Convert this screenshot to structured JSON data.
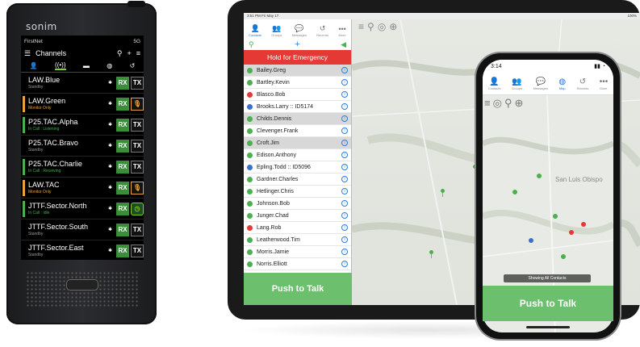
{
  "handset": {
    "brand": "sonim",
    "status_left": "FirstNet",
    "status_right": "5G",
    "title": "Channels",
    "tab_icons": [
      "person-icon",
      "radio-icon",
      "bus-icon",
      "globe-icon",
      "history-icon"
    ],
    "channels": [
      {
        "name": "LAW.Blue",
        "status": "Standby",
        "bar": "",
        "status_color": "#9a9a9a",
        "tx": "TX"
      },
      {
        "name": "LAW.Green",
        "status": "Monitor Only",
        "bar": "#e8a33c",
        "status_color": "#e8a33c",
        "tx": "🎙"
      },
      {
        "name": "P25.TAC.Alpha",
        "status": "In Call : Listening",
        "bar": "#4caf50",
        "status_color": "#4caf50",
        "tx": "TX"
      },
      {
        "name": "P25.TAC.Bravo",
        "status": "Standby",
        "bar": "",
        "status_color": "#9a9a9a",
        "tx": "TX"
      },
      {
        "name": "P25.TAC.Charlie",
        "status": "In Call : Receiving",
        "bar": "#4caf50",
        "status_color": "#4caf50",
        "tx": "TX"
      },
      {
        "name": "LAW.TAC",
        "status": "Monitor Only",
        "bar": "#e8a33c",
        "status_color": "#e8a33c",
        "tx": "🎙"
      },
      {
        "name": "JTTF.Sector.North",
        "status": "In Call : Idle",
        "bar": "#4caf50",
        "status_color": "#4caf50",
        "tx": "◷"
      },
      {
        "name": "JTTF.Sector.South",
        "status": "Standby",
        "bar": "",
        "status_color": "#9a9a9a",
        "tx": "TX"
      },
      {
        "name": "JTTF.Sector.East",
        "status": "Standby",
        "bar": "",
        "status_color": "#9a9a9a",
        "tx": "TX"
      }
    ],
    "rx_label": "RX"
  },
  "tablet": {
    "status_left": "3:51 PM  Fri May 17",
    "status_right": "100%",
    "tabs": [
      {
        "label": "Contacts",
        "icon": "person-icon",
        "active": true
      },
      {
        "label": "Groups",
        "icon": "group-icon",
        "active": false
      },
      {
        "label": "Messages",
        "icon": "messages-icon",
        "active": false
      },
      {
        "label": "Recents",
        "icon": "history-icon",
        "active": false
      },
      {
        "label": "More",
        "icon": "more-icon",
        "active": false
      }
    ],
    "emergency_label": "Hold for Emergency",
    "contacts": [
      {
        "name": "Bailey.Greg",
        "color": "green",
        "selected": true
      },
      {
        "name": "Bartley.Kevin",
        "color": "green",
        "selected": false
      },
      {
        "name": "Blasco.Bob",
        "color": "red",
        "selected": false
      },
      {
        "name": "Brooks.Larry :: ID5174",
        "color": "blue",
        "selected": false
      },
      {
        "name": "Childs.Dennis",
        "color": "green",
        "selected": true
      },
      {
        "name": "Clevenger.Frank",
        "color": "green",
        "selected": false
      },
      {
        "name": "Croft.Jim",
        "color": "green",
        "selected": true
      },
      {
        "name": "Edison.Anthony",
        "color": "green",
        "selected": false
      },
      {
        "name": "Epling.Todd :: ID5096",
        "color": "blue",
        "selected": false
      },
      {
        "name": "Gardner.Charles",
        "color": "green",
        "selected": false
      },
      {
        "name": "Hetlinger.Chris",
        "color": "green",
        "selected": false
      },
      {
        "name": "Johnson.Bob",
        "color": "green",
        "selected": false
      },
      {
        "name": "Junger.Chad",
        "color": "green",
        "selected": false
      },
      {
        "name": "Lang.Rob",
        "color": "red",
        "selected": false
      },
      {
        "name": "Leatherwood.Tim",
        "color": "green",
        "selected": false
      },
      {
        "name": "Morris.Jamie",
        "color": "green",
        "selected": false
      },
      {
        "name": "Norris.Elliott",
        "color": "green",
        "selected": false
      }
    ],
    "ptt_label": "Push to Talk"
  },
  "phone": {
    "time": "3:14",
    "tabs": [
      {
        "label": "Contacts",
        "icon": "person-icon",
        "active": false
      },
      {
        "label": "Groups",
        "icon": "group-icon",
        "active": false
      },
      {
        "label": "Messages",
        "icon": "messages-icon",
        "active": false
      },
      {
        "label": "Map",
        "icon": "globe-icon",
        "active": true
      },
      {
        "label": "Recents",
        "icon": "history-icon",
        "active": false
      },
      {
        "label": "More",
        "icon": "more-icon",
        "active": false
      }
    ],
    "city_label": "San Luis Obispo",
    "showing_label": "Showing All Contacts",
    "ptt_label": "Push to Talk"
  },
  "colors": {
    "accent_green": "#6bbf6d",
    "emergency_red": "#e53935",
    "link_blue": "#2a7de1"
  }
}
